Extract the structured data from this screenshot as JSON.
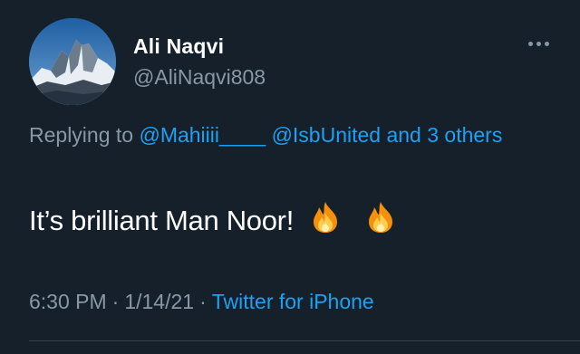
{
  "author": {
    "name": "Ali Naqvi",
    "handle": "@AliNaqvi808",
    "avatar_icon": "mountain-avatar"
  },
  "reply": {
    "prefix": "Replying to",
    "mentions": [
      "@Mahiiii____",
      "@IsbUnited",
      "and 3 others"
    ]
  },
  "tweet": {
    "text": "It’s brilliant Man Noor!",
    "emojis": [
      "fire",
      "fire"
    ]
  },
  "meta": {
    "time": "6:30 PM",
    "date": "1/14/21",
    "separator": "·",
    "source": "Twitter for iPhone"
  },
  "colors": {
    "background": "#15202b",
    "link": "#1da1f2",
    "secondary_text": "#8899a6",
    "primary_text": "#ffffff"
  }
}
